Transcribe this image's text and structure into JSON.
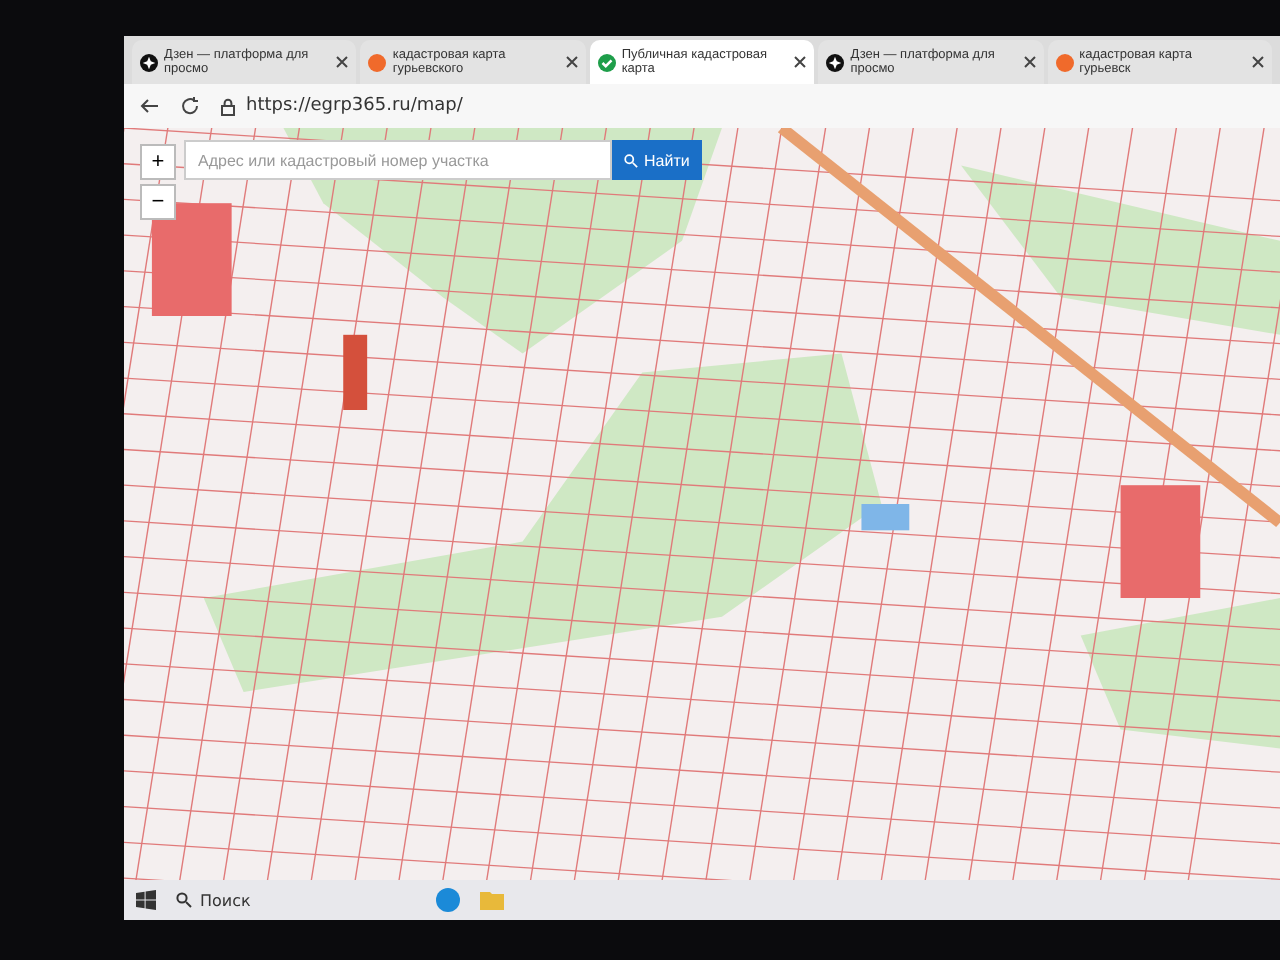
{
  "tabs": [
    {
      "label": "Дзен — платформа для просмо",
      "selected": false,
      "kind": "dzen"
    },
    {
      "label": "кадастровая карта гурьевского",
      "selected": false,
      "kind": "search"
    },
    {
      "label": "Публичная кадастровая карта",
      "selected": true,
      "kind": "check"
    },
    {
      "label": "Дзен — платформа для просмо",
      "selected": false,
      "kind": "dzen"
    },
    {
      "label": "кадастровая карта гурьевск",
      "selected": false,
      "kind": "search"
    }
  ],
  "address_bar": {
    "url": "https://egrp365.ru/map/"
  },
  "map_search": {
    "placeholder": "Адрес или кадастровый номер участка",
    "button": "Найти"
  },
  "zoom_controls": [
    "+",
    "−"
  ],
  "taskbar": {
    "search_placeholder": "Поиск"
  }
}
